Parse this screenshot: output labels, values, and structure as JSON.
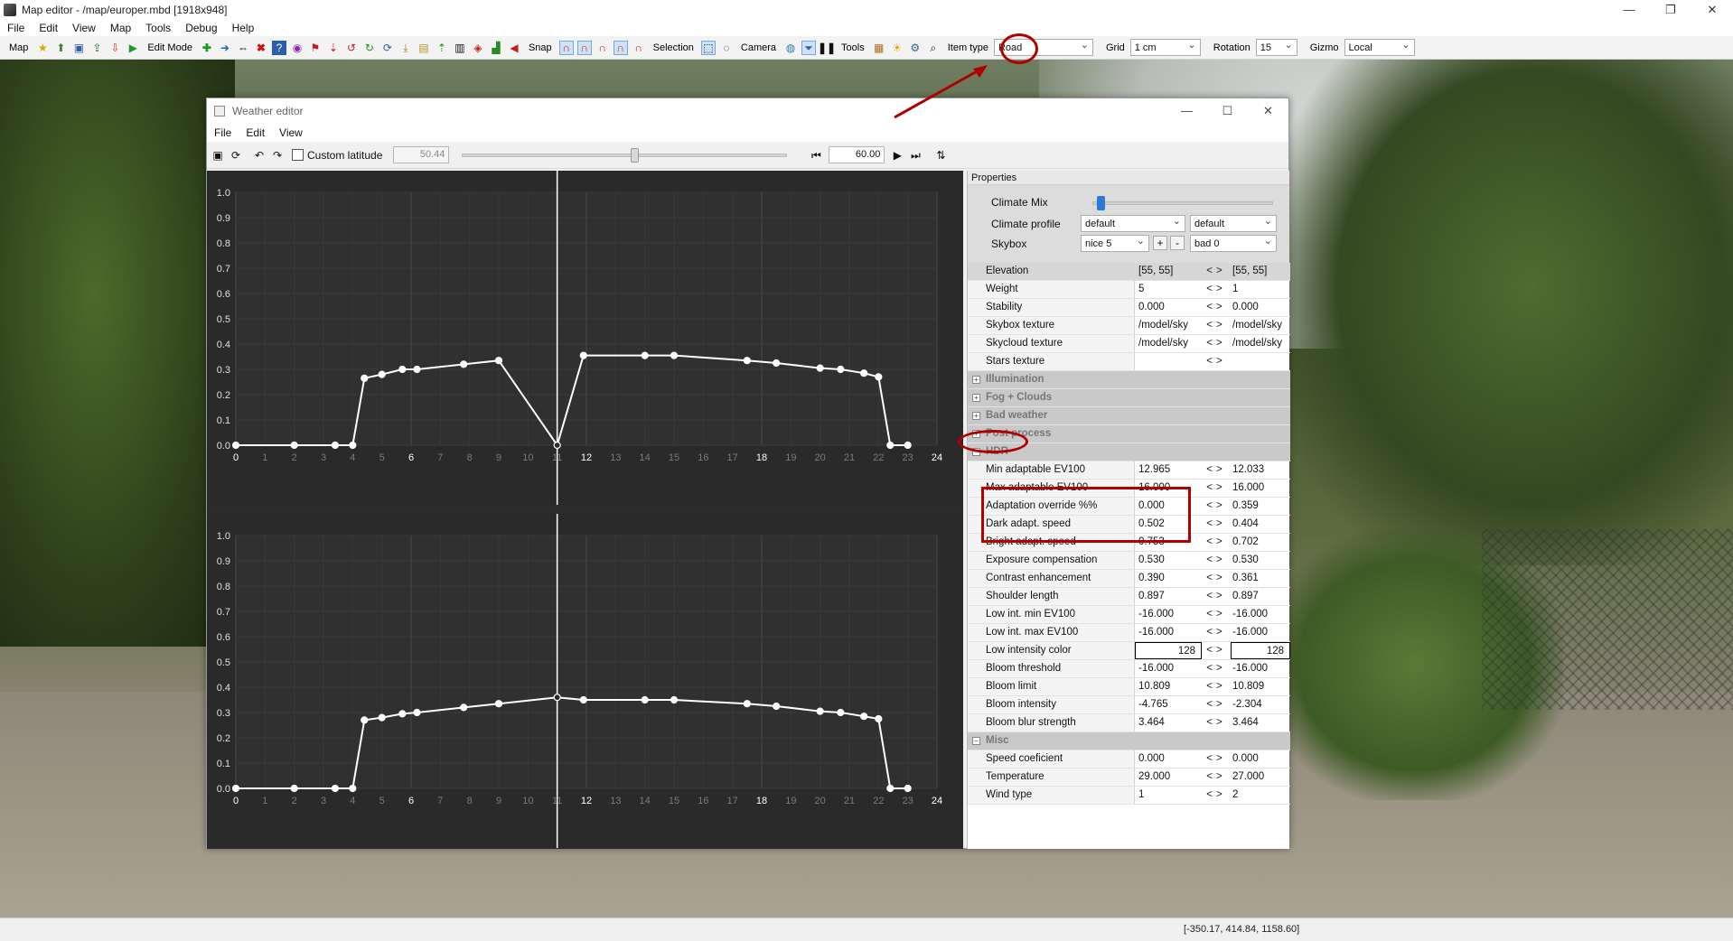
{
  "app": {
    "title": "Map editor - /map/europer.mbd [1918x948]",
    "menu": [
      "File",
      "Edit",
      "View",
      "Map",
      "Tools",
      "Debug",
      "Help"
    ]
  },
  "toolbar": {
    "map_label": "Map",
    "edit_mode_label": "Edit Mode",
    "snap_label": "Snap",
    "selection_label": "Selection",
    "camera_label": "Camera",
    "tools_label": "Tools",
    "item_type_label": "Item type",
    "item_type_value": "Road",
    "grid_label": "Grid",
    "grid_value": "1 cm",
    "rotation_label": "Rotation",
    "rotation_value": "15",
    "gizmo_label": "Gizmo",
    "gizmo_value": "Local"
  },
  "weather_editor": {
    "title": "Weather editor",
    "menu": [
      "File",
      "Edit",
      "View"
    ],
    "custom_latitude_label": "Custom latitude",
    "latitude_value": "50.44",
    "time_value": "60.00"
  },
  "chart_data": [
    {
      "type": "line",
      "x": [
        0,
        2,
        3.4,
        4,
        4.4,
        5,
        5.7,
        6.2,
        7.8,
        9,
        11,
        11.9,
        14,
        15,
        17.5,
        18.5,
        20,
        20.7,
        21.5,
        22,
        22.4,
        23
      ],
      "y": [
        0,
        0,
        0,
        0,
        0.265,
        0.28,
        0.3,
        0.3,
        0.32,
        0.335,
        0,
        0.355,
        0.355,
        0.355,
        0.335,
        0.325,
        0.305,
        0.3,
        0.285,
        0.27,
        0,
        0
      ],
      "xlim": [
        0,
        24
      ],
      "ylim": [
        0,
        1
      ],
      "x_ticks": [
        "0",
        "1",
        "2",
        "3",
        "4",
        "5",
        "6",
        "7",
        "8",
        "9",
        "10",
        "11",
        "12",
        "13",
        "14",
        "15",
        "16",
        "17",
        "18",
        "19",
        "20",
        "21",
        "22",
        "23",
        "24"
      ],
      "y_ticks": [
        "0.0",
        "0.1",
        "0.2",
        "0.3",
        "0.4",
        "0.5",
        "0.6",
        "0.7",
        "0.8",
        "0.9",
        "1.0"
      ],
      "cursor_x": 11
    },
    {
      "type": "line",
      "x": [
        0,
        2,
        3.4,
        4,
        4.4,
        5,
        5.7,
        6.2,
        7.8,
        9,
        11,
        11.9,
        14,
        15,
        17.5,
        18.5,
        20,
        20.7,
        21.5,
        22,
        22.4,
        23
      ],
      "y": [
        0,
        0,
        0,
        0,
        0.27,
        0.28,
        0.295,
        0.3,
        0.32,
        0.335,
        0.36,
        0.35,
        0.35,
        0.35,
        0.335,
        0.325,
        0.305,
        0.3,
        0.285,
        0.275,
        0,
        0
      ],
      "xlim": [
        0,
        24
      ],
      "ylim": [
        0,
        1
      ],
      "x_ticks": [
        "0",
        "1",
        "2",
        "3",
        "4",
        "5",
        "6",
        "7",
        "8",
        "9",
        "10",
        "11",
        "12",
        "13",
        "14",
        "15",
        "16",
        "17",
        "18",
        "19",
        "20",
        "21",
        "22",
        "23",
        "24"
      ],
      "y_ticks": [
        "0.0",
        "0.1",
        "0.2",
        "0.3",
        "0.4",
        "0.5",
        "0.6",
        "0.7",
        "0.8",
        "0.9",
        "1.0"
      ],
      "cursor_x": 11
    }
  ],
  "properties": {
    "header": "Properties",
    "climate_mix_label": "Climate Mix",
    "climate_mix_level": 0.02,
    "climate_profile_label": "Climate profile",
    "climate_profile_1": "default",
    "climate_profile_2": "default",
    "skybox_label": "Skybox",
    "skybox_1": "nice 5",
    "skybox_2": "bad 0",
    "rows": [
      {
        "kind": "header",
        "name": "Elevation",
        "v1": "[55, 55]",
        "v2": "[55, 55]"
      },
      {
        "kind": "row",
        "name": "Weight",
        "v1": "5",
        "v2": "1"
      },
      {
        "kind": "row",
        "name": "Stability",
        "v1": "0.000",
        "v2": "0.000"
      },
      {
        "kind": "row",
        "name": "Skybox texture",
        "v1": "/model/sky",
        "v2": "/model/sky"
      },
      {
        "kind": "row",
        "name": "Skycloud texture",
        "v1": "/model/sky",
        "v2": "/model/sky"
      },
      {
        "kind": "row",
        "name": "Stars texture",
        "v1": "",
        "v2": ""
      },
      {
        "kind": "section",
        "name": "Illumination",
        "expander": "+"
      },
      {
        "kind": "section",
        "name": "Fog + Clouds",
        "expander": "+"
      },
      {
        "kind": "section",
        "name": "Bad weather",
        "expander": "+"
      },
      {
        "kind": "section",
        "name": "Post process",
        "expander": "+"
      },
      {
        "kind": "section",
        "name": "HDR",
        "expander": "−"
      },
      {
        "kind": "row",
        "name": "Min adaptable EV100",
        "v1": "12.965",
        "v2": "12.033"
      },
      {
        "kind": "row",
        "name": "Max adaptable EV100",
        "v1": "16.000",
        "v2": "16.000"
      },
      {
        "kind": "row",
        "name": "Adaptation override %%",
        "v1": "0.000",
        "v2": "0.359"
      },
      {
        "kind": "row",
        "name": "Dark adapt. speed",
        "v1": "0.502",
        "v2": "0.404"
      },
      {
        "kind": "row",
        "name": "Bright adapt. speed",
        "v1": "0.753",
        "v2": "0.702"
      },
      {
        "kind": "row",
        "name": "Exposure compensation",
        "v1": "0.530",
        "v2": "0.530"
      },
      {
        "kind": "row",
        "name": "Contrast enhancement",
        "v1": "0.390",
        "v2": "0.361"
      },
      {
        "kind": "row",
        "name": "Shoulder length",
        "v1": "0.897",
        "v2": "0.897"
      },
      {
        "kind": "row",
        "name": "Low int. min EV100",
        "v1": "-16.000",
        "v2": "-16.000"
      },
      {
        "kind": "row",
        "name": "Low int. max EV100",
        "v1": "-16.000",
        "v2": "-16.000"
      },
      {
        "kind": "row",
        "name": "Low intensity color",
        "v1": "128",
        "v2": "128"
      },
      {
        "kind": "row",
        "name": "Bloom threshold",
        "v1": "-16.000",
        "v2": "-16.000"
      },
      {
        "kind": "row",
        "name": "Bloom limit",
        "v1": "10.809",
        "v2": "10.809"
      },
      {
        "kind": "row",
        "name": "Bloom intensity",
        "v1": "-4.765",
        "v2": "-2.304"
      },
      {
        "kind": "row",
        "name": "Bloom blur strength",
        "v1": "3.464",
        "v2": "3.464"
      },
      {
        "kind": "section",
        "name": "Misc",
        "expander": "−"
      },
      {
        "kind": "row",
        "name": "Speed coeficient",
        "v1": "0.000",
        "v2": "0.000"
      },
      {
        "kind": "row",
        "name": "Temperature",
        "v1": "29.000",
        "v2": "27.000"
      },
      {
        "kind": "row",
        "name": "Wind type",
        "v1": "1",
        "v2": "2"
      }
    ]
  },
  "status": {
    "coords": "[-350.17, 414.84, 1158.60]"
  },
  "colors": {
    "annotation": "#b00000",
    "graph_bg": "#2a2a2a",
    "curve": "#ffffff"
  }
}
